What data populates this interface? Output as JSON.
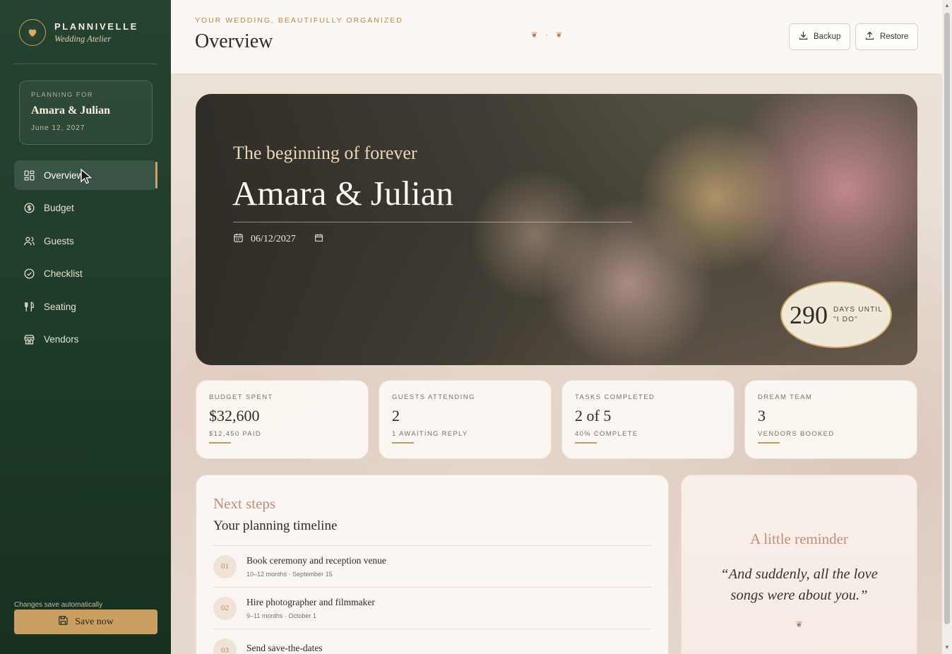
{
  "brand": {
    "name": "PLANNIVELLE",
    "subtitle": "Wedding Atelier",
    "logo_icon": "heart-icon"
  },
  "planning": {
    "label": "PLANNING FOR",
    "couple": "Amara & Julian",
    "date": "June 12, 2027"
  },
  "nav": {
    "items": [
      {
        "label": "Overview",
        "icon": "grid-icon",
        "active": true
      },
      {
        "label": "Budget",
        "icon": "dollar-circle-icon"
      },
      {
        "label": "Guests",
        "icon": "users-icon"
      },
      {
        "label": "Checklist",
        "icon": "check-circle-icon"
      },
      {
        "label": "Seating",
        "icon": "utensils-icon"
      },
      {
        "label": "Vendors",
        "icon": "store-icon"
      }
    ]
  },
  "footer": {
    "autosave": "Changes save automatically",
    "save_label": "Save now"
  },
  "header": {
    "eyebrow": "YOUR WEDDING, BEAUTIFULLY ORGANIZED",
    "title": "Overview",
    "ornament": "❦ · ❦",
    "backup_label": "Backup",
    "restore_label": "Restore"
  },
  "hero": {
    "tagline": "The beginning of forever",
    "names": "Amara & Julian",
    "date_value": "06/12/2027",
    "days": "290",
    "days_label": "DAYS UNTIL \"I DO\""
  },
  "stats": [
    {
      "label": "BUDGET SPENT",
      "value": "$32,600",
      "sub": "$12,450 PAID"
    },
    {
      "label": "GUESTS ATTENDING",
      "value": "2",
      "sub": "1 AWAITING REPLY"
    },
    {
      "label": "TASKS COMPLETED",
      "value": "2 of 5",
      "sub": "40% COMPLETE"
    },
    {
      "label": "DREAM TEAM",
      "value": "3",
      "sub": "VENDORS BOOKED"
    }
  ],
  "steps": {
    "kicker": "Next steps",
    "title": "Your planning timeline",
    "items": [
      {
        "num": "01",
        "title": "Book ceremony and reception venue",
        "meta": "10–12 months · September 15"
      },
      {
        "num": "02",
        "title": "Hire photographer and filmmaker",
        "meta": "9–11 months · October 1"
      },
      {
        "num": "03",
        "title": "Send save-the-dates",
        "meta": ""
      }
    ]
  },
  "reminder": {
    "title": "A little reminder",
    "quote": "“And suddenly, all the love songs were about you.”",
    "ornament": "❦"
  },
  "colors": {
    "sidebar": "#1f3d2b",
    "accent": "#c9a062",
    "rose": "#c08d7c"
  }
}
